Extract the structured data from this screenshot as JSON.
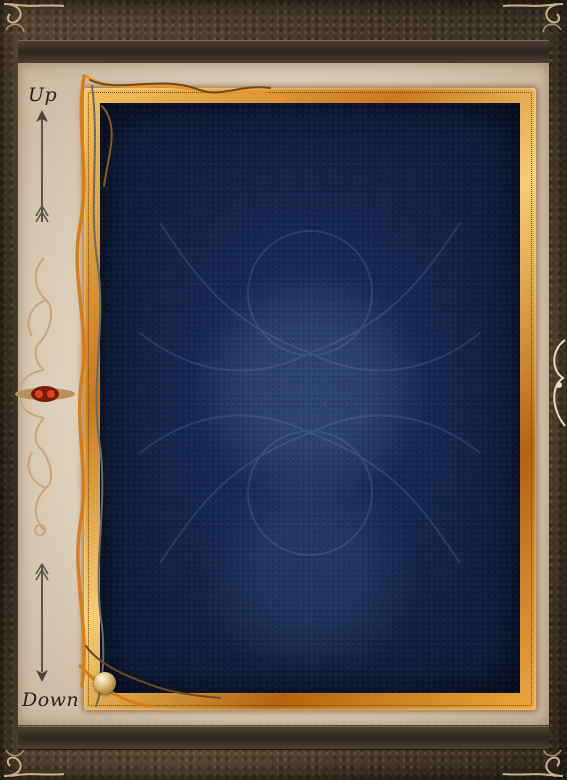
{
  "scroll": {
    "up_label": "Up",
    "down_label": "Down"
  },
  "colors": {
    "panel_blue": "#152750",
    "gold": "#e9a93e",
    "parchment": "#ddd0bb",
    "frame_dark": "#3d3226"
  },
  "icons": {
    "scroll_up": "arrow-up-icon",
    "scroll_down": "arrow-down-icon",
    "jewel": "jewel-ornament-icon"
  }
}
